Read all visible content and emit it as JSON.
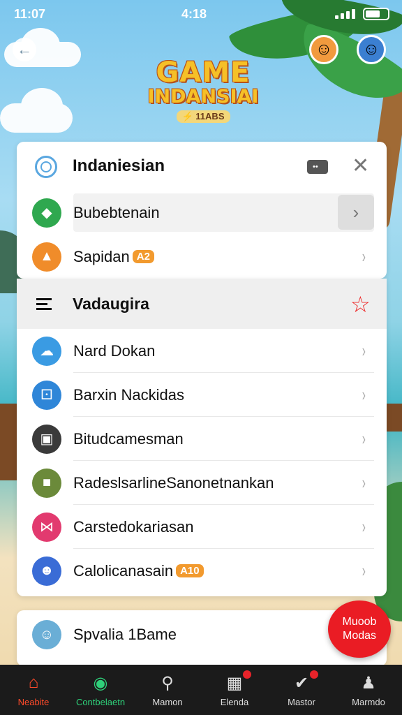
{
  "status": {
    "time_left": "11:07",
    "time_center": "4:18"
  },
  "logo": {
    "line1": "GAME",
    "line2": "INDANSIAI",
    "line3": "⚡ 11ABS"
  },
  "card1": {
    "header": {
      "title": "Indaniesian"
    },
    "rows": [
      {
        "label": "Bubebtenain",
        "icon": "diamond-icon",
        "color": "#2fa84f",
        "badge": ""
      },
      {
        "label": "Sapidan",
        "icon": "pizza-icon",
        "color": "#f08c2a",
        "badge": "A2"
      }
    ]
  },
  "section": {
    "title": "Vadaugira"
  },
  "card2": {
    "rows": [
      {
        "label": "Nard Dokan",
        "icon": "cloud-icon",
        "color": "#3a9be3",
        "badge": ""
      },
      {
        "label": "Barxin Nackidas",
        "icon": "dice-icon",
        "color": "#2f86d8",
        "badge": ""
      },
      {
        "label": "Bitudcamesman",
        "icon": "robot-icon",
        "color": "#3a3a3a",
        "badge": ""
      },
      {
        "label": "RadeslsarlineSanonetnankan",
        "icon": "game-board-icon",
        "color": "#6b8a3a",
        "badge": ""
      },
      {
        "label": "Carstedokariasan",
        "icon": "bow-icon",
        "color": "#e23a6f",
        "badge": ""
      },
      {
        "label": "Calolicanasain",
        "icon": "character-icon",
        "color": "#3a6cd6",
        "badge": "A10"
      }
    ]
  },
  "card3": {
    "row": {
      "label": "Spvalia 1Bame",
      "icon": "player-avatar-icon",
      "color": "#6aaed6"
    }
  },
  "fab": {
    "line1": "Muoob",
    "line2": "Modas"
  },
  "nav": [
    {
      "label": "Neabite",
      "icon": "home-icon",
      "state": "active-red"
    },
    {
      "label": "Contbelaetn",
      "icon": "chat-icon",
      "state": "active-green"
    },
    {
      "label": "Mamon",
      "icon": "search-icon",
      "state": ""
    },
    {
      "label": "Elenda",
      "icon": "gallery-icon",
      "state": "",
      "dot": true
    },
    {
      "label": "Mastor",
      "icon": "check-icon",
      "state": "",
      "dot": true
    },
    {
      "label": "Marmdo",
      "icon": "profile-icon",
      "state": ""
    }
  ]
}
